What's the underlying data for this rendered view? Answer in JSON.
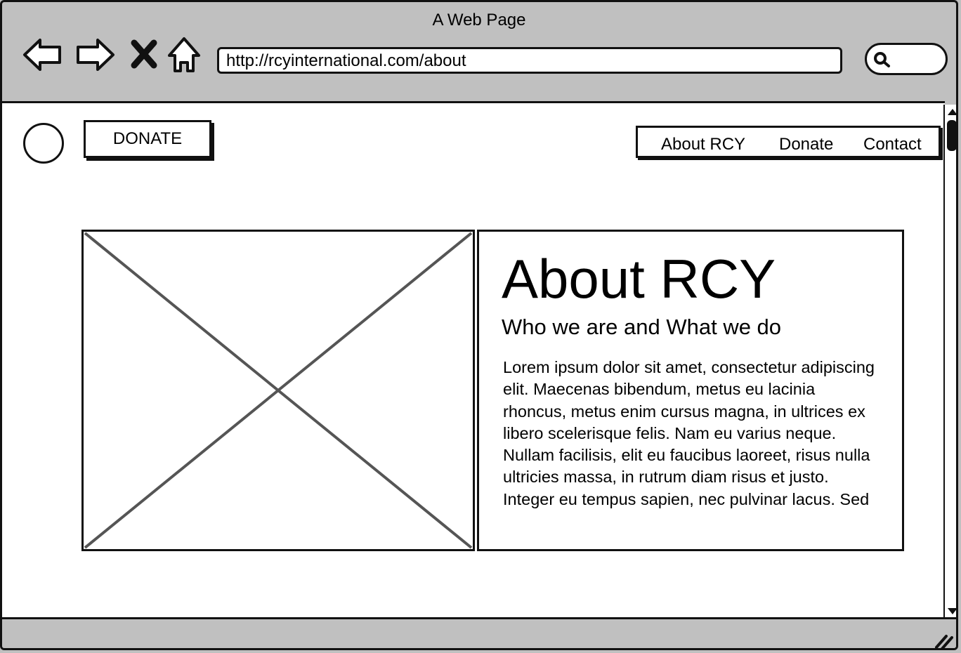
{
  "browser": {
    "title": "A Web Page",
    "url": "http://rcyinternational.com/about",
    "icons": [
      "back-arrow-icon",
      "forward-arrow-icon",
      "stop-x-icon",
      "home-icon",
      "search-icon",
      "resize-grip-icon"
    ]
  },
  "header": {
    "donate_button": "DONATE",
    "nav": [
      "About RCY",
      "Donate",
      "Contact"
    ]
  },
  "about": {
    "heading": "About RCY",
    "subheading": "Who we are and What we do",
    "body": "Lorem ipsum dolor sit amet, consectetur adipiscing elit. Maecenas bibendum, metus eu lacinia rhoncus, metus enim cursus magna, in ultrices ex libero scelerisque felis. Nam eu varius neque. Nullam facilisis, elit eu faucibus laoreet, risus nulla ultricies massa, in rutrum diam risus et justo. Integer eu tempus sapien, nec pulvinar lacus. Sed"
  }
}
